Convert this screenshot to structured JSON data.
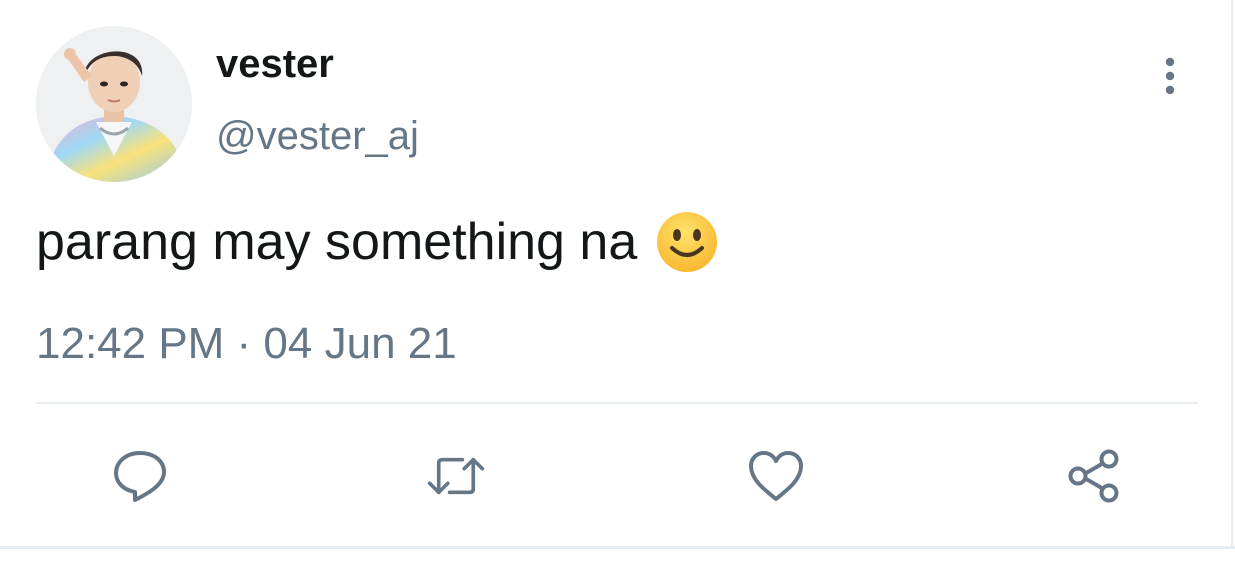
{
  "tweet": {
    "author": {
      "display_name": "vester",
      "handle": "@vester_aj",
      "avatar": "profile-photo"
    },
    "text": "parang may something na",
    "emoji": "slightly-smiling-face",
    "timestamp": "12:42 PM · 04 Jun 21"
  },
  "actions": [
    {
      "icon": "reply-icon"
    },
    {
      "icon": "retweet-icon"
    },
    {
      "icon": "like-icon"
    },
    {
      "icon": "share-icon"
    }
  ],
  "menu_icon": "more-options-icon",
  "colors": {
    "text_primary": "#14171a",
    "text_secondary": "#657786",
    "divider": "#e6ecf0",
    "icon": "#657786"
  }
}
